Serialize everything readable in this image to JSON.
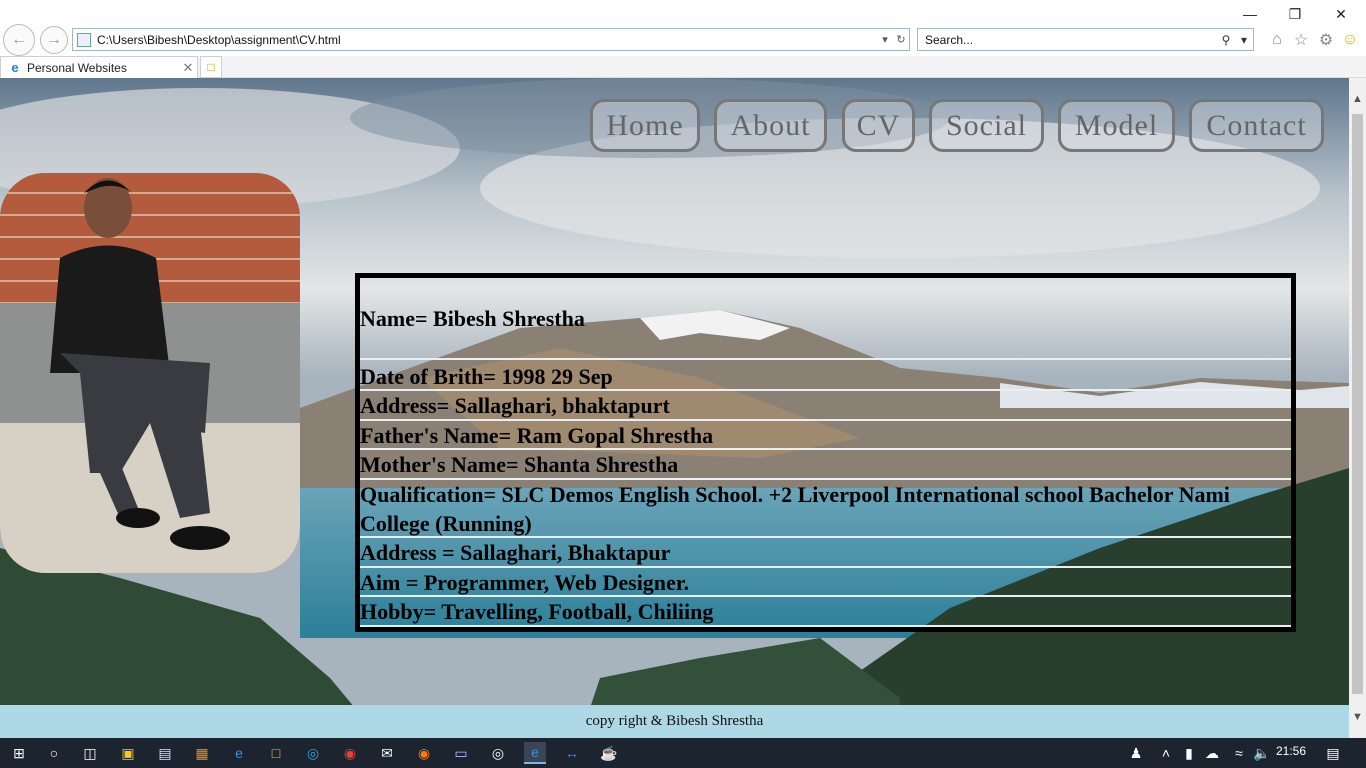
{
  "browser": {
    "address": "C:\\Users\\Bibesh\\Desktop\\assignment\\CV.html",
    "search_placeholder": "Search...",
    "tab_title": "Personal Websites"
  },
  "nav": [
    {
      "label": "Home"
    },
    {
      "label": "About"
    },
    {
      "label": "CV"
    },
    {
      "label": "Social"
    },
    {
      "label": "Model"
    },
    {
      "label": "Contact"
    }
  ],
  "cv": {
    "rows": [
      "Name= Bibesh Shrestha",
      "Date of Brith= 1998 29 Sep",
      "Address= Sallaghari, bhaktapurt",
      "Father's Name= Ram Gopal Shrestha",
      "Mother's Name= Shanta Shrestha",
      "Qualification= SLC Demos English School. +2 Liverpool International school Bachelor Nami College (Running)",
      "Address = Sallaghari, Bhaktapur",
      "Aim = Programmer, Web Designer.",
      "Hobby= Travelling, Football, Chiliing"
    ]
  },
  "footer": {
    "text": "copy right & Bibesh Shrestha"
  },
  "taskbar": {
    "time": "21:56"
  },
  "colors": {
    "footer_bg": "#add8e6",
    "nav_border": "#777777",
    "taskbar_bg": "#1c2430"
  }
}
